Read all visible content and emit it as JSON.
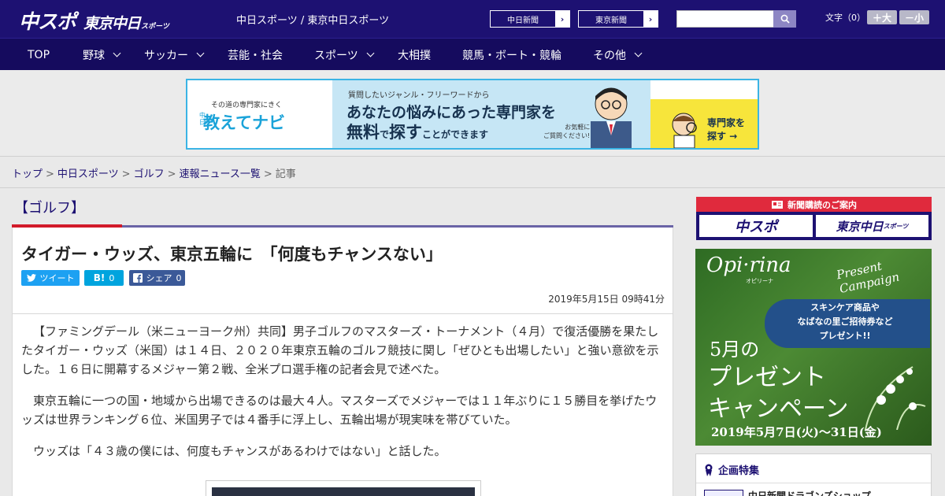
{
  "header": {
    "logo_main": "中スポ",
    "logo_tokyo": "東京中日",
    "logo_sub": "スポーツ",
    "site_title": "中日スポーツ / 東京中日スポーツ",
    "paper_buttons": [
      "中日新聞",
      "東京新聞"
    ],
    "search": {
      "placeholder": ""
    },
    "font_size_label": "文字（0）",
    "font_larger": "＋大",
    "font_smaller": "－小"
  },
  "nav": {
    "items": [
      {
        "label": "TOP",
        "dropdown": false
      },
      {
        "label": "野球",
        "dropdown": true
      },
      {
        "label": "サッカー",
        "dropdown": true
      },
      {
        "label": "芸能・社会",
        "dropdown": false
      },
      {
        "label": "スポーツ",
        "dropdown": true
      },
      {
        "label": "大相撲",
        "dropdown": false
      },
      {
        "label": "競馬・ボート・競輪",
        "dropdown": false
      },
      {
        "label": "その他",
        "dropdown": true
      }
    ]
  },
  "ad": {
    "left_small": "その道の専門家にきく",
    "left_tag": "中日",
    "left_big": "教えてナビ",
    "mid_line1": "質問したいジャンル・フリーワードから",
    "mid_line2": "あなたの悩みにあった専門家を",
    "mid_line3a": "無料",
    "mid_line3b": "で",
    "mid_line3c": "探す",
    "mid_line3d": "ことができます",
    "mid_note1": "お気軽に",
    "mid_note2": "ご質問ください!",
    "right_line1": "専門家を",
    "right_line2": "探す →"
  },
  "breadcrumb": {
    "items": [
      "トップ",
      "中日スポーツ",
      "ゴルフ",
      "速報ニュース一覧"
    ],
    "current": "記事",
    "separator": ">"
  },
  "article": {
    "category": "【ゴルフ】",
    "title": "タイガー・ウッズ、東京五輪に　「何度もチャンスない」",
    "share": {
      "tweet_label": "ツイート",
      "hatena_label": "B!",
      "hatena_count": "0",
      "facebook_label": "シェア",
      "facebook_count": "0"
    },
    "date": "2019年5月15日 09時41分",
    "paragraphs": [
      "【ファミングデール（米ニューヨーク州）共同】男子ゴルフのマスターズ・トーナメント（４月）で復活優勝を果たしたタイガー・ウッズ（米国）は１４日、２０２０年東京五輪のゴルフ競技に関し「ぜひとも出場したい」と強い意欲を示した。１６日に開幕するメジャー第２戦、全米プロ選手権の記者会見で述べた。",
      "東京五輪に一つの国・地域から出場できるのは最大４人。マスターズでメジャーでは１１年ぶりに１５勝目を挙げたウッズは世界ランキング６位、米国男子では４番手に浮上し、五輪出場が現実味を帯びていた。",
      "ウッズは「４３歳の僕には、何度もチャンスがあるわけではない」と話した。"
    ]
  },
  "sidebar": {
    "subscription_title": "新聞購読のご案内",
    "sub_logo_1": "中スポ",
    "sub_logo_2": "東京中日",
    "sub_logo_2_small": "スポーツ",
    "promo": {
      "brand": "Opi·rina",
      "brand_sub": "オピリーナ",
      "campaign": "Present Campaign",
      "line1": "スキンケア商品や",
      "line2": "なばなの里ご招待券など",
      "line3": "プレゼント!!",
      "month": "5月の",
      "big1": "プレゼント",
      "big2": "キャンペーン",
      "dates": "2019年5月7日(火)〜31日(金)"
    },
    "feature_title": "企画特集",
    "feature_item": "中日新聞ドラゴンズショップ"
  },
  "colors": {
    "header_bg": "#1d1172",
    "nav_bg": "#150b5e",
    "accent_red": "#d21b2a",
    "ad_border": "#3bb4e5",
    "twitter": "#1da1f2",
    "hatena": "#00a4de",
    "facebook": "#3b5998"
  }
}
